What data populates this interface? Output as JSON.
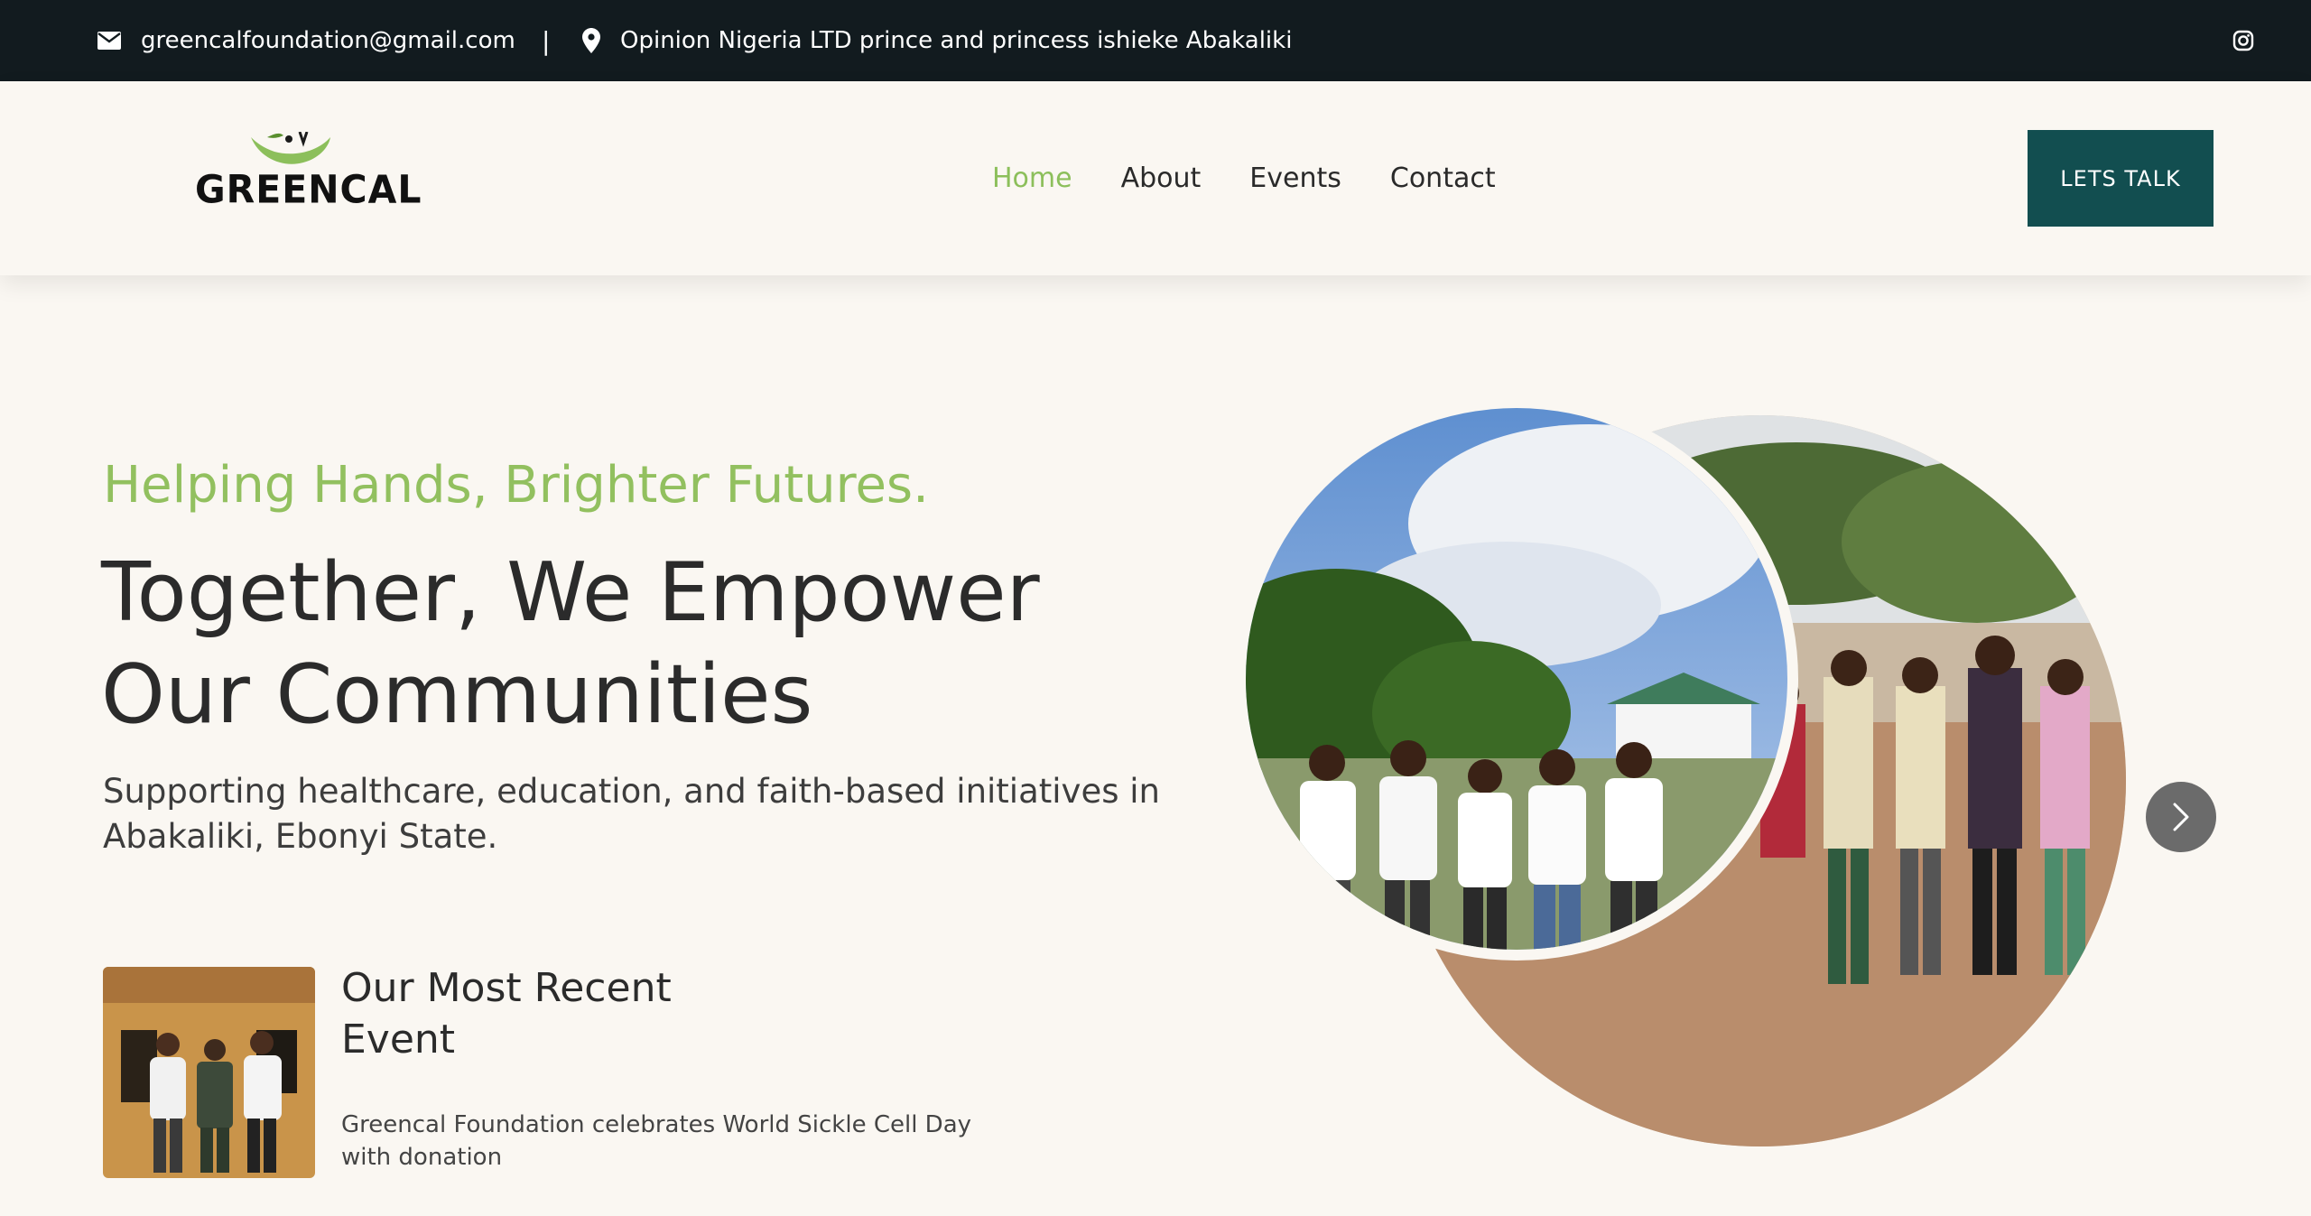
{
  "topbar": {
    "email": "greencalfoundation@gmail.com",
    "separator": "|",
    "location": "Opinion Nigeria LTD prince and princess ishieke Abakaliki",
    "icons": {
      "email": "envelope-icon",
      "location": "map-pin-icon",
      "social": "instagram-icon"
    }
  },
  "nav": {
    "logo_text": "GREENCAL",
    "links": [
      {
        "label": "Home",
        "active": true
      },
      {
        "label": "About",
        "active": false
      },
      {
        "label": "Events",
        "active": false
      },
      {
        "label": "Contact",
        "active": false
      }
    ],
    "cta_label": "LETS TALK"
  },
  "hero": {
    "tagline": "Helping Hands, Brighter Futures.",
    "headline_line1": "Together, We Empower",
    "headline_line2": "Our Communities",
    "subtitle": "Supporting healthcare, education, and faith-based initiatives in Abakaliki, Ebonyi State."
  },
  "recent_event": {
    "title_line1": "Our Most Recent",
    "title_line2": "Event",
    "description": "Greencal Foundation celebrates World Sickle Cell Day with donation"
  },
  "carousel": {
    "next_icon": "chevron-right-icon"
  },
  "colors": {
    "topbar_bg": "#121b1f",
    "page_bg": "#faf7f2",
    "accent_green": "#8cbf5b",
    "cta_bg": "#124e50",
    "carousel_btn": "#6b6b6b"
  }
}
